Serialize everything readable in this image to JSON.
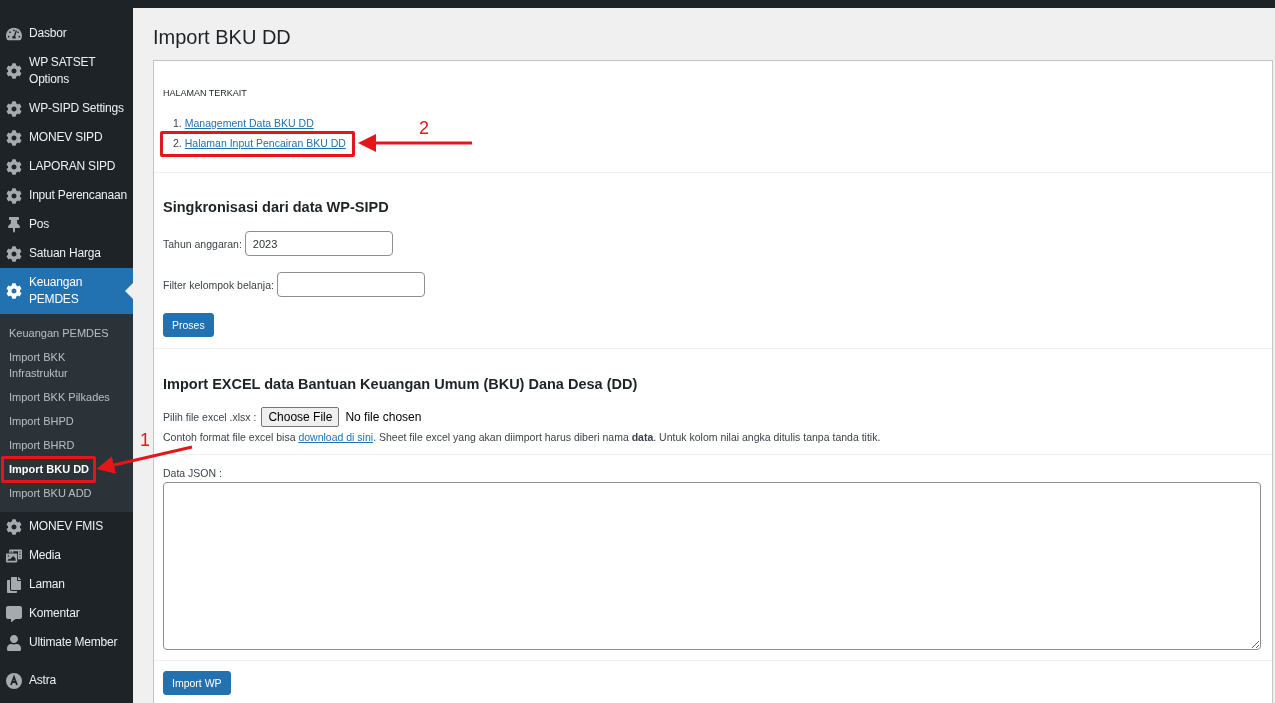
{
  "sidebar": {
    "items": [
      {
        "label": "Dasbor",
        "kind": "dashboard",
        "selected": false
      },
      {
        "label": "WP SATSET Options",
        "kind": "gear",
        "selected": false
      },
      {
        "label": "WP-SIPD Settings",
        "kind": "gear",
        "selected": false
      },
      {
        "label": "MONEV SIPD",
        "kind": "gear",
        "selected": false
      },
      {
        "label": "LAPORAN SIPD",
        "kind": "gear",
        "selected": false
      },
      {
        "label": "Input Perencanaan",
        "kind": "gear",
        "selected": false
      },
      {
        "label": "Pos",
        "kind": "pin",
        "selected": false
      },
      {
        "label": "Satuan Harga",
        "kind": "gear",
        "selected": false
      },
      {
        "label": "Keuangan PEMDES",
        "kind": "gear",
        "selected": true,
        "children": [
          {
            "label": "Keuangan PEMDES",
            "selected": false
          },
          {
            "label": "Import BKK Infrastruktur",
            "selected": false
          },
          {
            "label": "Import BKK Pilkades",
            "selected": false
          },
          {
            "label": "Import BHPD",
            "selected": false
          },
          {
            "label": "Import BHRD",
            "selected": false
          },
          {
            "label": "Import BKU DD",
            "selected": true
          },
          {
            "label": "Import BKU ADD",
            "selected": false
          }
        ]
      },
      {
        "label": "MONEV FMIS",
        "kind": "gear",
        "selected": false
      },
      {
        "label": "Media",
        "kind": "media",
        "selected": false
      },
      {
        "label": "Laman",
        "kind": "pages",
        "selected": false
      },
      {
        "label": "Komentar",
        "kind": "comment",
        "selected": false
      },
      {
        "label": "Ultimate Member",
        "kind": "user",
        "selected": false
      },
      {
        "label": "Astra",
        "kind": "astra",
        "selected": false
      }
    ]
  },
  "page": {
    "title": "Import BKU DD",
    "related": {
      "heading": "HALAMAN TERKAIT",
      "links": [
        {
          "number": "1.",
          "label": "Management Data BKU DD"
        },
        {
          "number": "2.",
          "label": "Halaman Input Pencairan BKU DD"
        }
      ]
    },
    "sync": {
      "heading": "Singkronisasi dari data WP-SIPD",
      "year_label": "Tahun anggaran:",
      "year_value": "2023",
      "filter_label": "Filter kelompok belanja:",
      "button": "Proses"
    },
    "excel": {
      "heading": "Import EXCEL data Bantuan Keuangan Umum (BKU) Dana Desa (DD)",
      "file_label": "Pilih file excel .xlsx :",
      "file_button": "Choose File",
      "file_status": "No file chosen",
      "note_before": "Contoh format file excel bisa ",
      "note_link": "download di sini",
      "note_after": ". Sheet file excel yang akan diimport harus diberi nama **data**. Untuk kolom nilai angka ditulis tanpa tanda titik."
    },
    "json": {
      "label": "Data JSON :"
    },
    "import_button": "Import WP"
  },
  "annotations": [
    {
      "label": "1"
    },
    {
      "label": "2"
    }
  ]
}
